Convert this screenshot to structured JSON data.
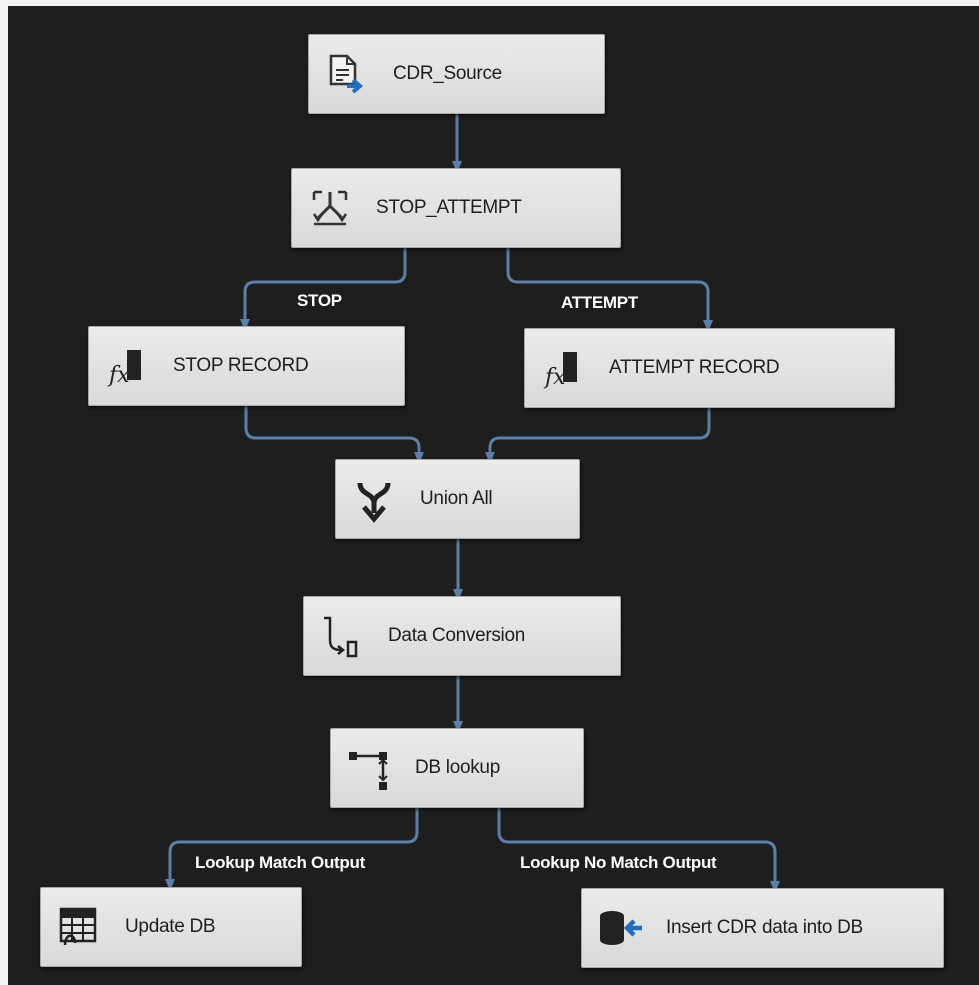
{
  "nodes": {
    "cdr_source": {
      "label": "CDR_Source",
      "icon": "flat-file-source-icon"
    },
    "stop_attempt": {
      "label": "STOP_ATTEMPT",
      "icon": "conditional-split-icon"
    },
    "stop_record": {
      "label": "STOP RECORD",
      "icon": "derived-column-icon"
    },
    "attempt_record": {
      "label": "ATTEMPT RECORD",
      "icon": "derived-column-icon"
    },
    "union_all": {
      "label": "Union All",
      "icon": "union-all-icon"
    },
    "data_conversion": {
      "label": "Data Conversion",
      "icon": "data-conversion-icon"
    },
    "db_lookup": {
      "label": "DB lookup",
      "icon": "lookup-icon"
    },
    "update_db": {
      "label": "Update DB",
      "icon": "ole-db-command-icon"
    },
    "insert_db": {
      "label": "Insert CDR data into DB",
      "icon": "ole-db-destination-icon"
    }
  },
  "path_labels": {
    "stop": "STOP",
    "attempt": "ATTEMPT",
    "lookup_match": "Lookup Match Output",
    "lookup_no_match": "Lookup No Match Output"
  },
  "colors": {
    "background": "#1e1e1e",
    "node_fill": "#e3e3e3",
    "connector": "#5b7fa8",
    "icon_blue": "#1f6fc1"
  }
}
